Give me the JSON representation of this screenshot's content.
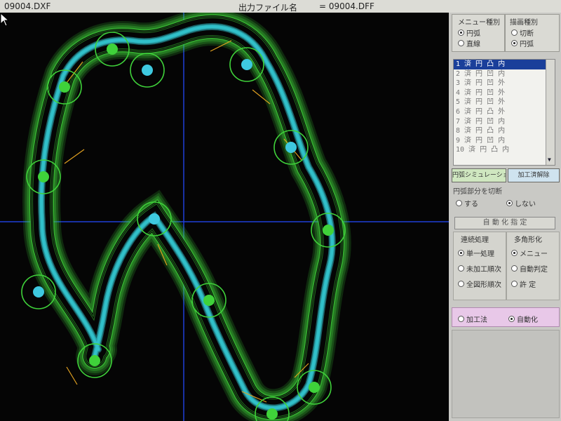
{
  "titlebar": {
    "file_name": "09004.DXF",
    "output_label": "出力ファイル名",
    "output_file": "= 09004.DFF"
  },
  "canvas": {
    "colors": {
      "background": "#050505",
      "outer_path": "#3fd23a",
      "inner_path": "#33c6d0",
      "node": "#3fd23a",
      "node_cyan": "#3ec9e0",
      "axis": "#1f3fd8",
      "lead": "#e0a020"
    }
  },
  "panel": {
    "menu_type": {
      "title": "メニュー種別",
      "options": [
        "円弧",
        "直線"
      ],
      "selected": 0
    },
    "draw_type": {
      "title": "描画種別",
      "options": [
        "切断",
        "円弧"
      ],
      "selected": 1
    },
    "list_items": [
      "1 済 円 凸 内",
      "2 済 円 凹 内",
      "3 済 円 凹 外",
      "4 済 円 凹 外",
      "5 済 円 凹 外",
      "6 済 円 凸 外",
      "7 済 円 凹 内",
      "8 済 円 凸 内",
      "9 済 円 凹 内",
      "10 済 円 凸 内"
    ],
    "list_selected": 0,
    "btn_simulation": "円弧シミュレーション",
    "btn_release": "加工済解除",
    "cut_question": "円弧部分を切断",
    "cut_options": [
      "する",
      "しない"
    ],
    "cut_selected": 1,
    "auto_header": "自 動 化 指 定",
    "left_group_title": "連続処理",
    "left_options": [
      "単一処理",
      "未加工順次",
      "全図形順次"
    ],
    "left_selected": 0,
    "right_group_title": "多角形化",
    "right_options": [
      "メニュー",
      "自動判定",
      "許 定"
    ],
    "right_selected": 0,
    "mode_options": [
      "加工法",
      "自動化"
    ],
    "mode_selected": 1
  }
}
